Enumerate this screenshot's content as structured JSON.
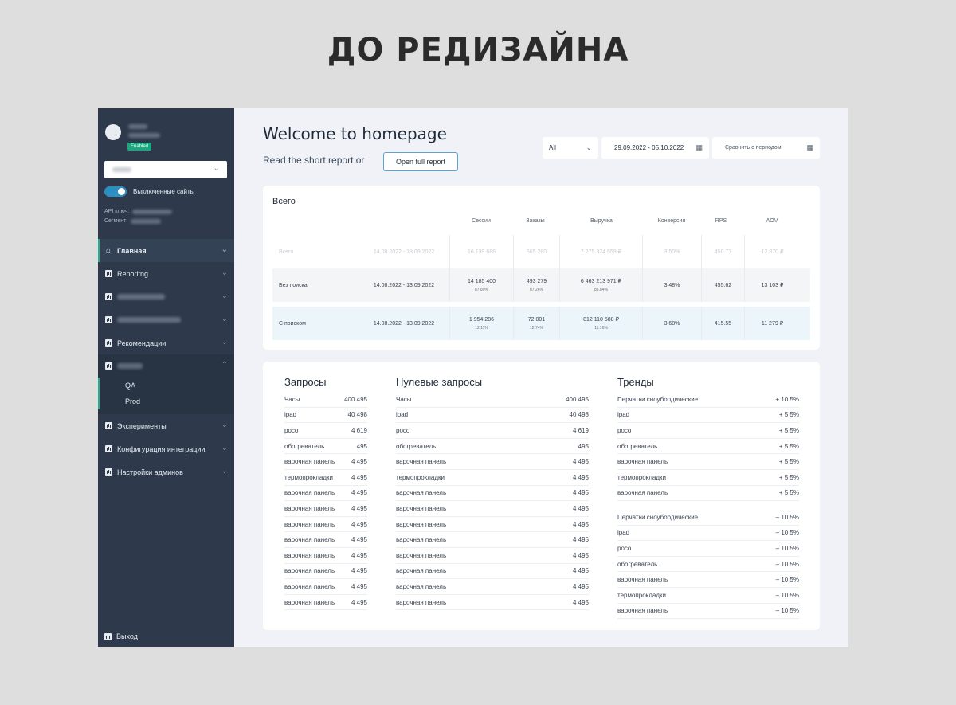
{
  "banner": "ДО РЕДИЗАЙНА",
  "sidebar": {
    "badge": "Enabled",
    "toggle_label": "Выключенные сайты",
    "api_label": "API ключ:",
    "segment_label": "Сегмент:",
    "nav": {
      "home": "Главная",
      "reporting": "Reporitng",
      "recommendations": "Рекомендации",
      "qa": "QA",
      "prod": "Prod",
      "experiments": "Эксперименты",
      "integration": "Конфигурация интеграции",
      "admin": "Настройки админов"
    },
    "exit": "Выход"
  },
  "header": {
    "title": "Welcome to homepage",
    "subtitle": "Read the short report or",
    "open_report": "Open full report",
    "filter_all": "All",
    "date_range": "29.09.2022 - 05.10.2022",
    "compare": "Сравнить с периодом"
  },
  "summary": {
    "title": "Всего",
    "headers": [
      "Сессии",
      "Заказы",
      "Выручка",
      "Конверсия",
      "RPS",
      "AOV"
    ],
    "rows": [
      {
        "name": "Всего",
        "period": "14.08.2022 - 13.09.2022",
        "sessions": "16 139 686",
        "orders": "565 280",
        "revenue": "7 275 324 559 ₽",
        "conversion": "3.50%",
        "rps": "450.77",
        "aov": "12 870 ₽"
      },
      {
        "name": "Без поиска",
        "period": "14.08.2022 - 13.09.2022",
        "sessions": "14 185 400",
        "sessions_pct": "87.89%",
        "orders": "493 279",
        "orders_pct": "87.26%",
        "revenue": "6 463 213 971 ₽",
        "revenue_pct": "88.84%",
        "conversion": "3.48%",
        "rps": "455.62",
        "aov": "13 103 ₽"
      },
      {
        "name": "С поиском",
        "period": "14.08.2022 - 13.09.2022",
        "sessions": "1 954 286",
        "sessions_pct": "12.11%",
        "orders": "72 001",
        "orders_pct": "12.74%",
        "revenue": "812 110 588 ₽",
        "revenue_pct": "11.16%",
        "conversion": "3.68%",
        "rps": "415.55",
        "aov": "11 279 ₽"
      }
    ]
  },
  "queries": {
    "title": "Запросы",
    "items": [
      [
        "Часы",
        "400 495"
      ],
      [
        "ipad",
        "40 498"
      ],
      [
        "poco",
        "4 619"
      ],
      [
        "обогреватель",
        "495"
      ],
      [
        "варочная панель",
        "4 495"
      ],
      [
        "термопрокладки",
        "4 495"
      ],
      [
        "варочная панель",
        "4 495"
      ],
      [
        "варочная панель",
        "4 495"
      ],
      [
        "варочная панель",
        "4 495"
      ],
      [
        "варочная панель",
        "4 495"
      ],
      [
        "варочная панель",
        "4 495"
      ],
      [
        "варочная панель",
        "4 495"
      ],
      [
        "варочная панель",
        "4 495"
      ],
      [
        "варочная панель",
        "4 495"
      ]
    ]
  },
  "zero_queries": {
    "title": "Нулевые запросы",
    "items": [
      [
        "Часы",
        "400 495"
      ],
      [
        "ipad",
        "40 498"
      ],
      [
        "poco",
        "4 619"
      ],
      [
        "обогреватель",
        "495"
      ],
      [
        "варочная панель",
        "4 495"
      ],
      [
        "термопрокладки",
        "4 495"
      ],
      [
        "варочная панель",
        "4 495"
      ],
      [
        "варочная панель",
        "4 495"
      ],
      [
        "варочная панель",
        "4 495"
      ],
      [
        "варочная панель",
        "4 495"
      ],
      [
        "варочная панель",
        "4 495"
      ],
      [
        "варочная панель",
        "4 495"
      ],
      [
        "варочная панель",
        "4 495"
      ],
      [
        "варочная панель",
        "4 495"
      ]
    ]
  },
  "trends": {
    "title": "Тренды",
    "up": [
      [
        "Перчатки сноубордические",
        "+ 10.5%"
      ],
      [
        "ipad",
        "+ 5.5%"
      ],
      [
        "poco",
        "+ 5.5%"
      ],
      [
        "обогреватель",
        "+ 5.5%"
      ],
      [
        "варочная панель",
        "+ 5.5%"
      ],
      [
        "термопрокладки",
        "+ 5.5%"
      ],
      [
        "варочная панель",
        "+ 5.5%"
      ]
    ],
    "down": [
      [
        "Перчатки сноубордические",
        "– 10.5%"
      ],
      [
        "ipad",
        "– 10.5%"
      ],
      [
        "poco",
        "– 10.5%"
      ],
      [
        "обогреватель",
        "– 10.5%"
      ],
      [
        "варочная панель",
        "– 10.5%"
      ],
      [
        "термопрокладки",
        "– 10.5%"
      ],
      [
        "варочная панель",
        "– 10.5%"
      ]
    ]
  }
}
